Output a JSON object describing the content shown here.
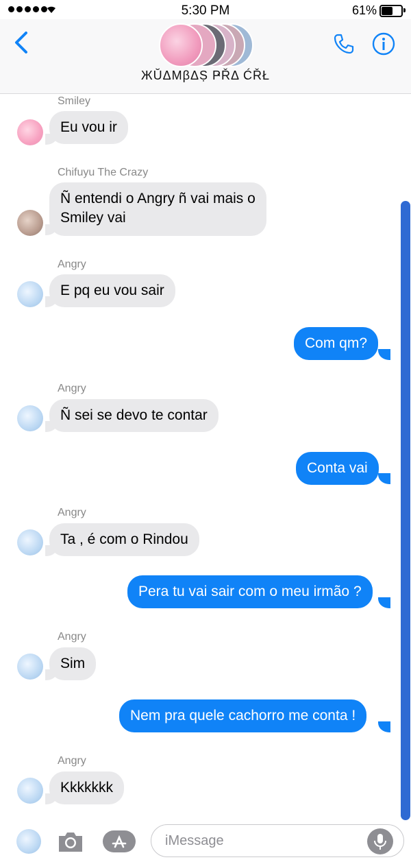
{
  "status_bar": {
    "time": "5:30 PM",
    "battery": "61%",
    "battery_level": 0.61
  },
  "header": {
    "group_name": "ЖŬΔΜβΔṢ ҎŘΔ ĆŘŁ"
  },
  "messages": [
    {
      "sender": "Smiley",
      "text": "Eu vou ir"
    },
    {
      "sender": "Chifuyu The Crazy",
      "lines": [
        "Ñ entendi o Angry ñ vai mais o",
        "Smiley vai"
      ]
    },
    {
      "sender": "Angry",
      "text": "E pq eu vou sair"
    },
    {
      "sender": "me",
      "text": "Com qm?"
    },
    {
      "sender": "Angry",
      "text": "Ñ sei se devo te contar"
    },
    {
      "sender": "me",
      "text": "Conta vai"
    },
    {
      "sender": "Angry",
      "text": "Ta , é com o Rindou"
    },
    {
      "sender": "me",
      "text": "Pera tu vai sair com o meu irmão ?"
    },
    {
      "sender": "Angry",
      "text": "Sim"
    },
    {
      "sender": "me",
      "text": "Nem pra quele cachorro me conta !"
    },
    {
      "sender": "Angry",
      "text": "Kkkkkkk"
    }
  ],
  "composer": {
    "placeholder": "iMessage"
  },
  "colors": {
    "accent": "#1083f7",
    "incoming_bubble": "#e9e9eb",
    "scrollbar": "#2f6ad3"
  }
}
